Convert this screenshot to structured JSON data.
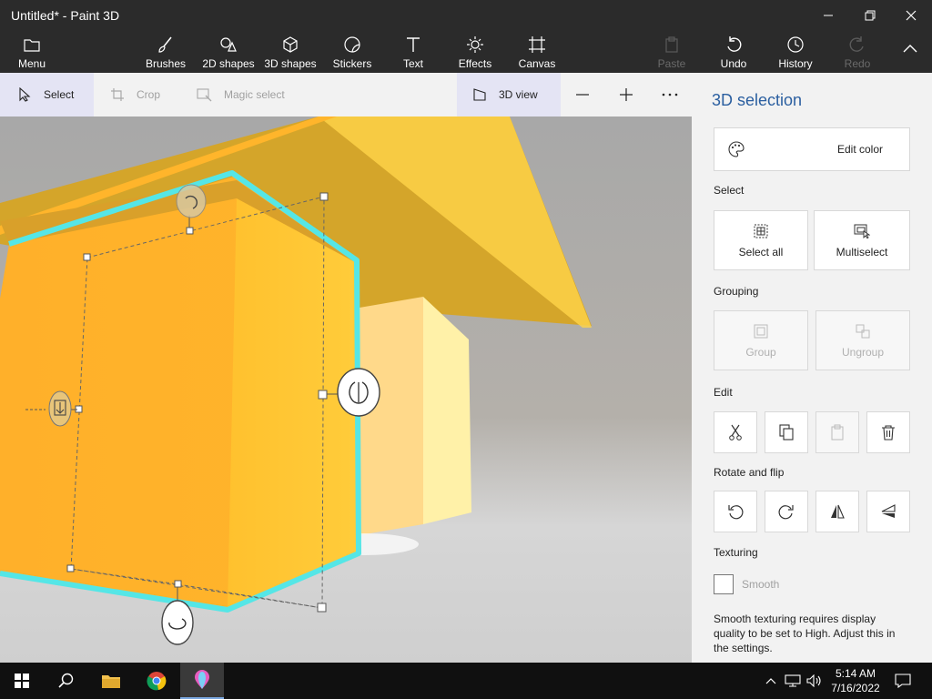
{
  "window": {
    "title": "Untitled* - Paint 3D"
  },
  "ribbon": {
    "menu": "Menu",
    "brushes": "Brushes",
    "shapes2d": "2D shapes",
    "shapes3d": "3D shapes",
    "stickers": "Stickers",
    "text": "Text",
    "effects": "Effects",
    "canvas": "Canvas",
    "paste": "Paste",
    "undo": "Undo",
    "history": "History",
    "redo": "Redo"
  },
  "toolstrip": {
    "select": "Select",
    "crop": "Crop",
    "magic_select": "Magic select",
    "view3d": "3D view"
  },
  "panel": {
    "title": "3D selection",
    "edit_color": "Edit color",
    "select_header": "Select",
    "select_all": "Select all",
    "multiselect": "Multiselect",
    "grouping_header": "Grouping",
    "group": "Group",
    "ungroup": "Ungroup",
    "edit_header": "Edit",
    "rotate_header": "Rotate and flip",
    "texturing_header": "Texturing",
    "smooth": "Smooth",
    "smooth_note": "Smooth texturing requires display quality to be set to High. Adjust this in the settings."
  },
  "taskbar": {
    "time": "5:14 AM",
    "date": "7/16/2022"
  },
  "colors": {
    "accent": "#2b5fa0",
    "selection": "#55e6e6",
    "shape": "#ffb727"
  }
}
